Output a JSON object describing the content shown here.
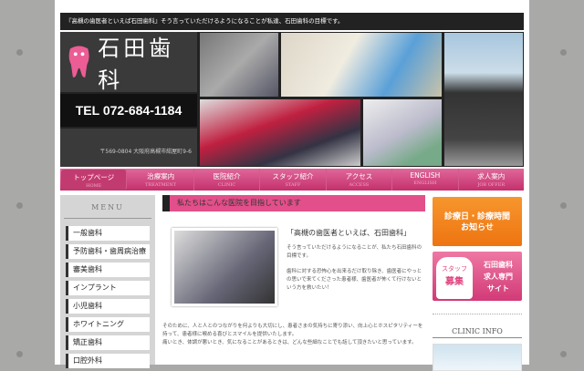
{
  "tagline": "『高槻の歯医者といえば石田歯科』そう言っていただけるようになることが私達、石田歯科の目標です。",
  "logo": "石田歯科",
  "tel": "TEL 072-684-1184",
  "address": "〒569-0804 大阪府高槻市紺屋町9-6",
  "nav": [
    {
      "ja": "トップページ",
      "en": "HOME"
    },
    {
      "ja": "治療案内",
      "en": "TREATMENT"
    },
    {
      "ja": "医院紹介",
      "en": "CLINIC"
    },
    {
      "ja": "スタッフ紹介",
      "en": "STAFF"
    },
    {
      "ja": "アクセス",
      "en": "ACCESS"
    },
    {
      "ja": "ENGLISH",
      "en": "ENGLISH"
    },
    {
      "ja": "求人案内",
      "en": "JOB OFFER"
    }
  ],
  "menu": {
    "title": "MENU",
    "items": [
      "一般歯科",
      "予防歯科・歯周病治療",
      "審美歯科",
      "インプラント",
      "小児歯科",
      "ホワイトニング",
      "矯正歯科",
      "口腔外科"
    ]
  },
  "main": {
    "heading": "私たちはこんな医院を目指しています",
    "quote": "「高槻の歯医者といえば、石田歯科」",
    "p1": "そう言っていただけるようになることが、私たち石田歯科の目標です。",
    "p2": "歯科に対する恐怖心を出来るだけ取り除き、歯医者にやっとの思いで来てくださった患者様、歯医者が怖くて行けないという方を救いたい！",
    "p3": "そのために、人と人とのつながりを何よりも大切にし、患者さまの気持ちに寄り添い、向上心とホスピタリティーを持って、患者様に喉める喜びとスマイルを提供いたします。",
    "p4": "痛いとき、体調が悪いとき、気になることがあるときは、どんな些細なことでも話して頂きたいと思っています。"
  },
  "side": {
    "b1_l1": "診療日・診療時間",
    "b1_l2": "お知らせ",
    "b2_left1": "スタッフ",
    "b2_left2": "募集",
    "b2_r1": "石田歯科",
    "b2_r2": "求人専門",
    "b2_r3": "サイト",
    "clinic_info": "CLINIC INFO"
  }
}
